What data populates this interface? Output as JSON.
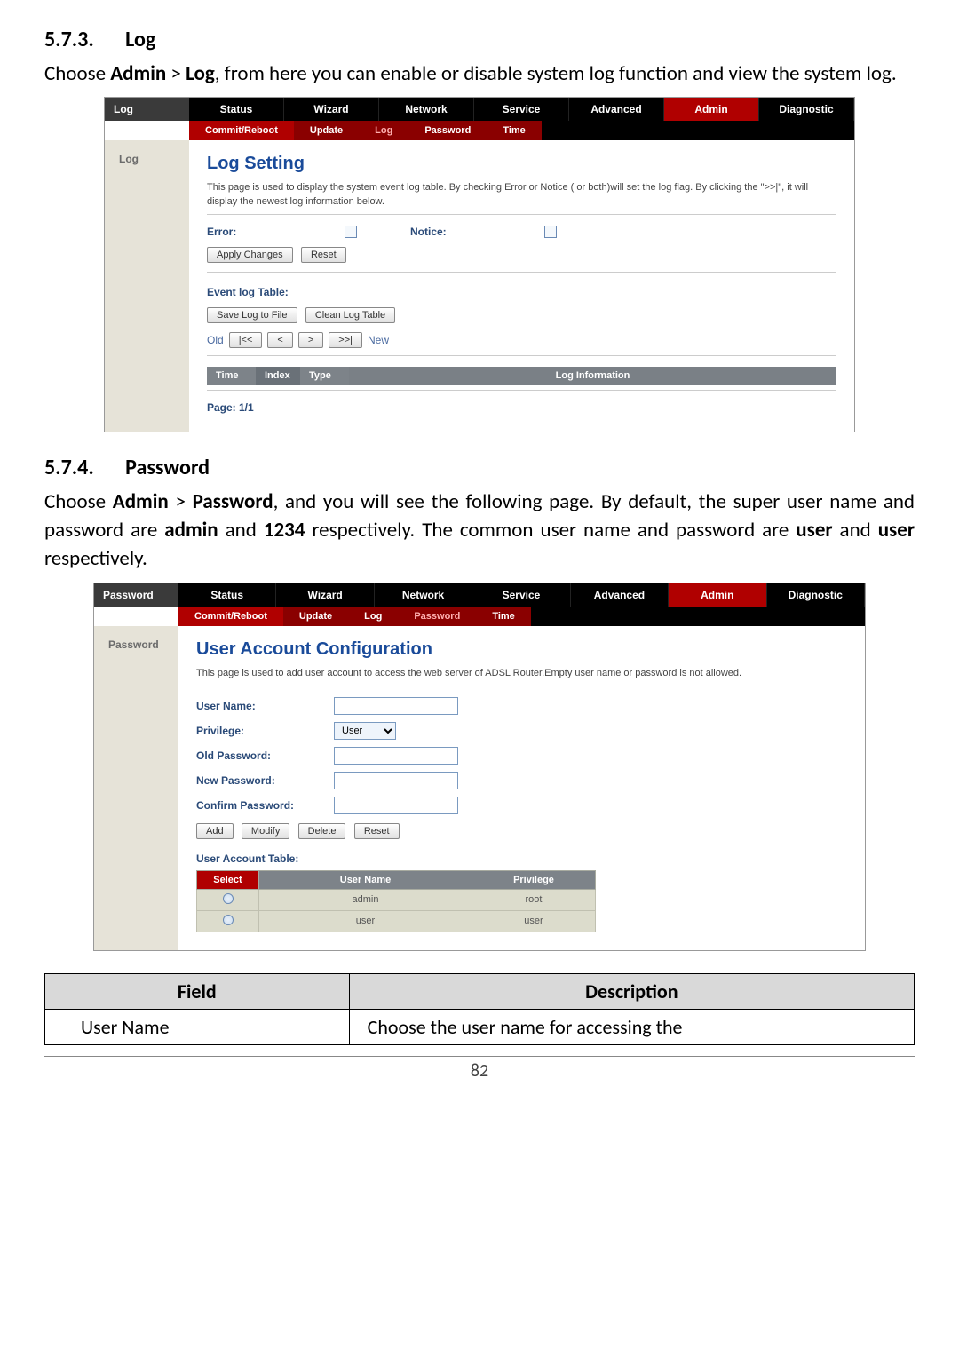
{
  "section1": {
    "num": "5.7.3.",
    "title": "Log",
    "body_prefix": "Choose ",
    "body_b1": "Admin",
    "body_mid": " > ",
    "body_b2": "Log",
    "body_suffix": ", from here you can enable or disable system log function and view the system log."
  },
  "shot1": {
    "left_label": "Log",
    "tabs": [
      "Status",
      "Wizard",
      "Network",
      "Service",
      "Advanced",
      "Admin",
      "Diagnostic"
    ],
    "subtabs": [
      "Commit/Reboot",
      "Update",
      "Log",
      "Password",
      "Time"
    ],
    "side": "Log",
    "title": "Log Setting",
    "desc": "This page is used to display the system event log table. By checking Error or Notice ( or both)will set the log flag. By clicking the \">>|\", it will display the newest log information below.",
    "error_label": "Error:",
    "notice_label": "Notice:",
    "apply": "Apply Changes",
    "reset": "Reset",
    "event_log": "Event log Table:",
    "save_log": "Save Log to File",
    "clean_log": "Clean Log Table",
    "old": "Old",
    "old_btn": "|<<",
    "prev": "<",
    "next": ">",
    "new_btn": ">>|",
    "new": "New",
    "th_time": "Time",
    "th_index": "Index",
    "th_type": "Type",
    "th_info": "Log Information",
    "page": "Page: 1/1"
  },
  "section2": {
    "num": "5.7.4.",
    "title": "Password",
    "body_prefix": "Choose ",
    "body_b1": "Admin",
    "body_mid1": " > ",
    "body_b2": "Password",
    "body_mid2": ", and you will see the following page. By default, the super user name and password are ",
    "body_b3": "admin",
    "body_mid3": " and ",
    "body_b4": "1234",
    "body_mid4": " respectively. The common user name and password are ",
    "body_b5": "user",
    "body_mid5": " and ",
    "body_b6": "user",
    "body_suffix": " respectively."
  },
  "shot2": {
    "left_label": "Password",
    "tabs": [
      "Status",
      "Wizard",
      "Network",
      "Service",
      "Advanced",
      "Admin",
      "Diagnostic"
    ],
    "subtabs": [
      "Commit/Reboot",
      "Update",
      "Log",
      "Password",
      "Time"
    ],
    "side": "Password",
    "title": "User Account Configuration",
    "desc": "This page is used to add user account to access the web server of ADSL Router.Empty user name or password is not allowed.",
    "user_name": "User Name:",
    "privilege": "Privilege:",
    "privilege_opt": "User",
    "old_pw": "Old Password:",
    "new_pw": "New Password:",
    "confirm_pw": "Confirm Password:",
    "add": "Add",
    "modify": "Modify",
    "delete": "Delete",
    "reset": "Reset",
    "table_title": "User Account Table:",
    "th_select": "Select",
    "th_user": "User Name",
    "th_priv": "Privilege",
    "rows": [
      {
        "user": "admin",
        "priv": "root"
      },
      {
        "user": "user",
        "priv": "user"
      }
    ]
  },
  "fd_table": {
    "field": "Field",
    "description": "Description",
    "row1_field": "User Name",
    "row1_desc": "Choose the user name for accessing the"
  },
  "page_number": "82"
}
